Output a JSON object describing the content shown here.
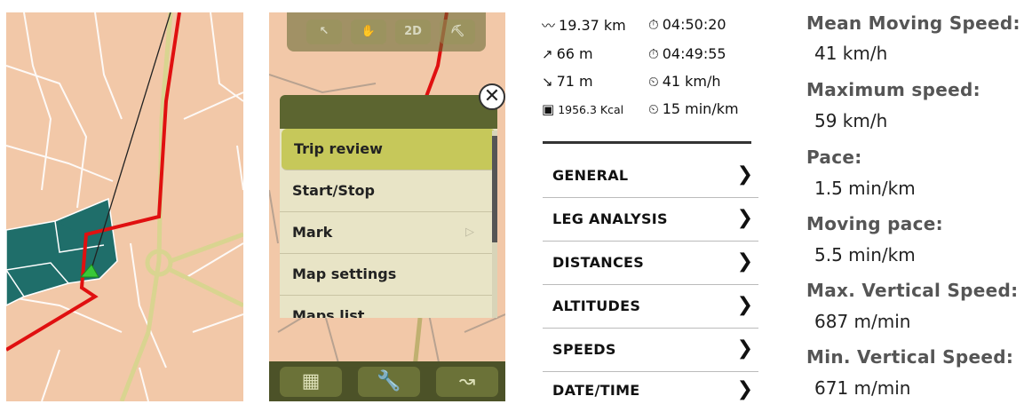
{
  "map_panel_2": {
    "top_buttons": [
      "",
      "",
      "2D",
      ""
    ],
    "menu_items": [
      {
        "label": "Trip review",
        "selected": true
      },
      {
        "label": "Start/Stop",
        "selected": false
      },
      {
        "label": "Mark",
        "selected": false,
        "arrow": "▷"
      },
      {
        "label": "Map settings",
        "selected": false
      },
      {
        "label": "Maps list",
        "selected": false
      }
    ],
    "close_symbol": "✕",
    "bottom_icons": [
      "grid-icon",
      "wrench-icon",
      "track-icon"
    ]
  },
  "stats": {
    "distance": "19.37 km",
    "total_time": "04:50:20",
    "ascent": "66 m",
    "moving_time": "04:49:55",
    "descent": "71 m",
    "avg_speed": "41 km/h",
    "calories": "1956.3 Kcal",
    "avg_pace": "15 min/km",
    "sections": [
      "GENERAL",
      "LEG ANALYSIS",
      "DISTANCES",
      "ALTITUDES",
      "SPEEDS",
      "DATE/TIME"
    ],
    "chevron": "❯"
  },
  "details": [
    {
      "label": "Mean Moving Speed:",
      "value": "41 km/h"
    },
    {
      "label": "Maximum speed:",
      "value": "59 km/h"
    },
    {
      "label": "Pace:",
      "value": "1.5 min/km"
    },
    {
      "label": "Moving pace:",
      "value": "5.5 min/km"
    },
    {
      "label": "Max. Vertical Speed:",
      "value": "687 m/min"
    },
    {
      "label": "Min. Vertical Speed:",
      "value": "671 m/min"
    }
  ],
  "colors": {
    "map_bg": "#f2c8a8",
    "route": "#e01010",
    "park": "#1f6e6a",
    "menu_selected": "#c6c85a"
  }
}
